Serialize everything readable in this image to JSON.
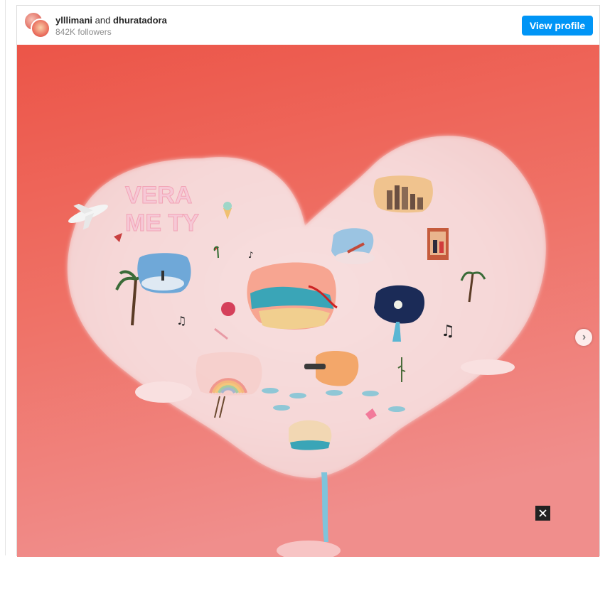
{
  "post": {
    "user1": "ylllimani",
    "connector": "and",
    "user2": "dhuratadora",
    "followers": "842K followers",
    "view_profile_label": "View profile"
  },
  "artwork": {
    "title_line1": "VERA",
    "title_line2": "ME TY"
  },
  "icons": {
    "next": "chevron-right-icon",
    "close": "close-icon"
  },
  "colors": {
    "accent": "#0095f6",
    "background_top": "#ec5b4d",
    "background_bottom": "#f08a89",
    "cloud": "#f7d4d4"
  }
}
